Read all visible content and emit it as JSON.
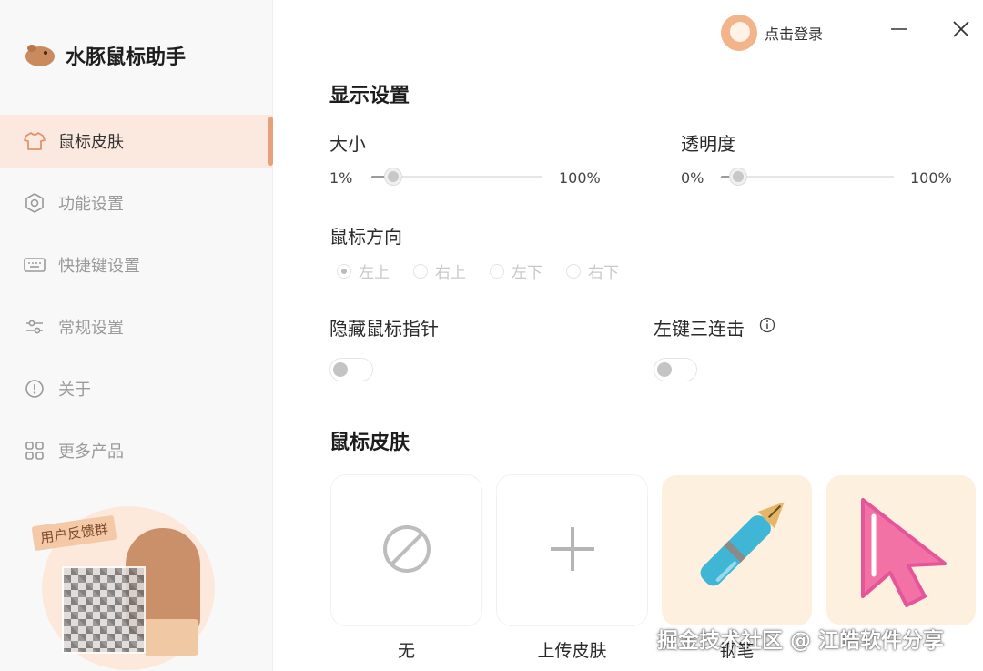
{
  "app": {
    "title": "水豚鼠标助手"
  },
  "sidebar": {
    "items": [
      {
        "label": "鼠标皮肤",
        "icon": "tshirt-icon",
        "active": true
      },
      {
        "label": "功能设置",
        "icon": "hexagon-gear-icon",
        "active": false
      },
      {
        "label": "快捷键设置",
        "icon": "keyboard-icon",
        "active": false
      },
      {
        "label": "常规设置",
        "icon": "sliders-icon",
        "active": false
      },
      {
        "label": "关于",
        "icon": "info-circle-icon",
        "active": false
      },
      {
        "label": "更多产品",
        "icon": "grid-icon",
        "active": false
      }
    ],
    "feedback_tag": "用户反馈群"
  },
  "header": {
    "login_label": "点击登录"
  },
  "display": {
    "title": "显示设置",
    "size": {
      "label": "大小",
      "min_label": "1%",
      "max_label": "100%",
      "value": 0.13
    },
    "opacity": {
      "label": "透明度",
      "min_label": "0%",
      "max_label": "100%",
      "value": 0.1
    }
  },
  "direction": {
    "label": "鼠标方向",
    "options": [
      "左上",
      "右上",
      "左下",
      "右下"
    ],
    "selected": "左上"
  },
  "hide_pointer": {
    "label": "隐藏鼠标指针",
    "enabled": false
  },
  "triple_click": {
    "label": "左键三连击",
    "enabled": false
  },
  "skins": {
    "title": "鼠标皮肤",
    "items": [
      {
        "label": "无",
        "icon": "no-sign-icon"
      },
      {
        "label": "上传皮肤",
        "icon": "plus-icon"
      },
      {
        "label": "钢笔",
        "icon": "fountain-pen-icon"
      },
      {
        "label": "",
        "icon": "pink-arrow-cursor-icon"
      }
    ]
  },
  "watermark": "掘金技术社区 @ 江皓软件分享",
  "colors": {
    "accent": "#e8a07a",
    "active_bg": "#fbe9df",
    "skin_bg": "#fdf0df"
  }
}
